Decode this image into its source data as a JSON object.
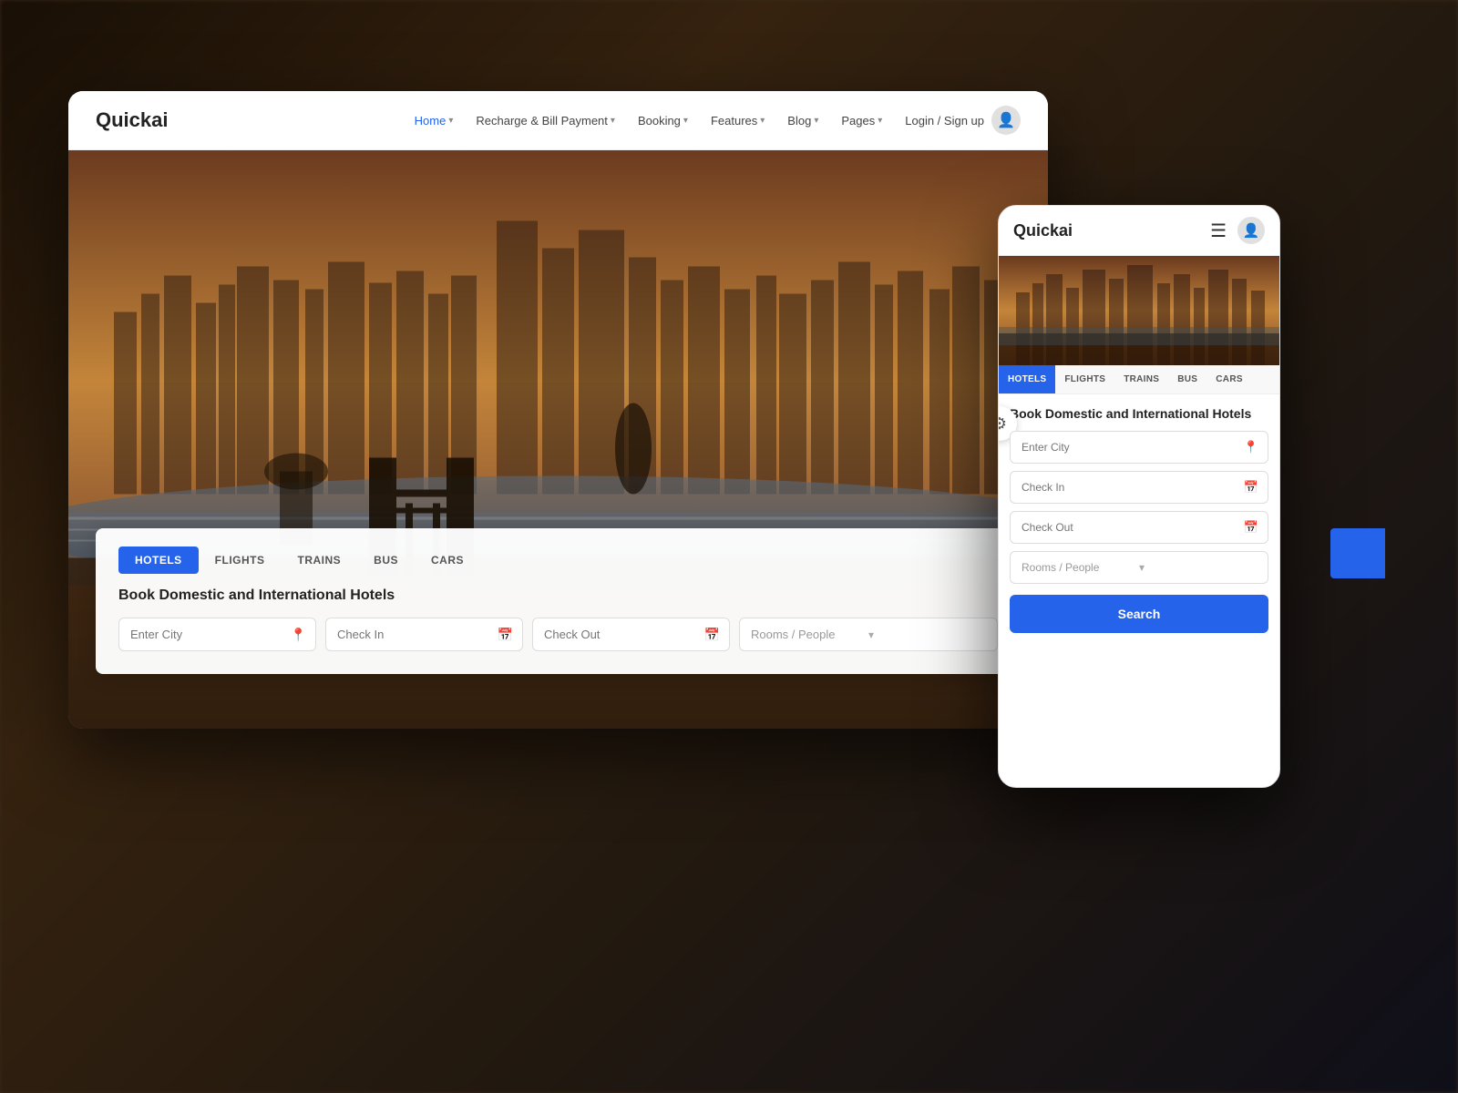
{
  "desktop": {
    "logo": "Quickai",
    "nav": {
      "items": [
        {
          "label": "Home",
          "active": true,
          "hasChevron": true
        },
        {
          "label": "Recharge & Bill Payment",
          "active": false,
          "hasChevron": true
        },
        {
          "label": "Booking",
          "active": false,
          "hasChevron": true
        },
        {
          "label": "Features",
          "active": false,
          "hasChevron": true
        },
        {
          "label": "Blog",
          "active": false,
          "hasChevron": true
        },
        {
          "label": "Pages",
          "active": false,
          "hasChevron": true
        }
      ],
      "loginLabel": "Login / Sign up"
    },
    "tabs": [
      {
        "label": "HOTELS",
        "active": true
      },
      {
        "label": "FLIGHTS",
        "active": false
      },
      {
        "label": "TRAINS",
        "active": false
      },
      {
        "label": "BUS",
        "active": false
      },
      {
        "label": "CARS",
        "active": false
      }
    ],
    "bookingTitle": "Book Domestic and International Hotels",
    "fields": {
      "city": {
        "placeholder": "Enter City"
      },
      "checkIn": {
        "placeholder": "Check In"
      },
      "checkOut": {
        "placeholder": "Check Out"
      },
      "rooms": {
        "placeholder": "Rooms / People"
      }
    }
  },
  "mobile": {
    "logo": "Quickai",
    "hamburgerIcon": "☰",
    "tabs": [
      {
        "label": "HOTELS",
        "active": true
      },
      {
        "label": "FLIGHTS",
        "active": false
      },
      {
        "label": "TRAINS",
        "active": false
      },
      {
        "label": "BUS",
        "active": false
      },
      {
        "label": "CARS",
        "active": false
      }
    ],
    "bookingTitle": "Book Domestic and International Hotels",
    "fields": {
      "city": {
        "placeholder": "Enter City"
      },
      "checkIn": {
        "placeholder": "Check In"
      },
      "checkOut": {
        "placeholder": "Check Out"
      },
      "rooms": {
        "placeholder": "Rooms / People"
      }
    },
    "searchLabel": "Search",
    "roomsPeopleLabel": "Rooms People",
    "searchPlaceholderLabel": "Search"
  },
  "icons": {
    "location": "📍",
    "calendar": "📅",
    "chevronDown": "▾",
    "user": "👤",
    "gear": "⚙"
  }
}
